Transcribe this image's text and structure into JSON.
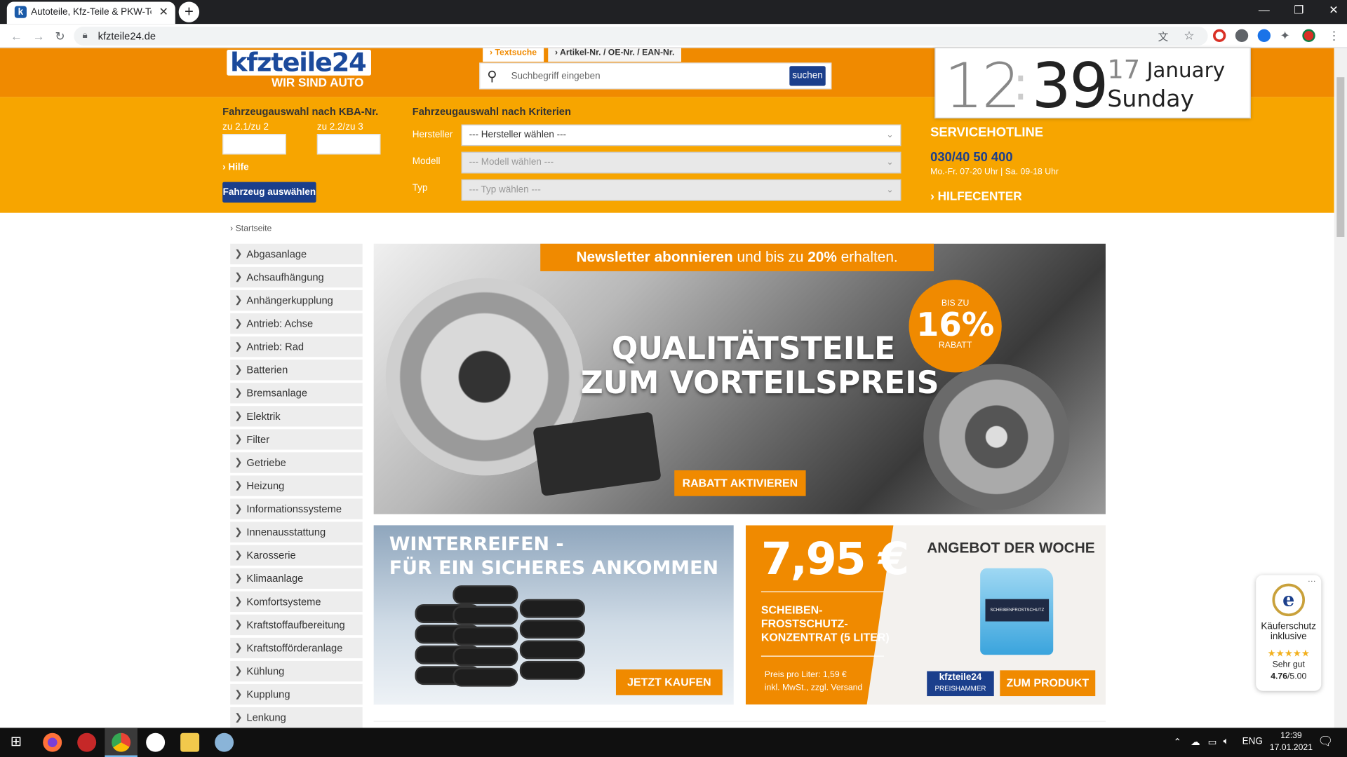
{
  "browser": {
    "tab_title": "Autoteile, Kfz-Teile & PKW-Teile",
    "tab_favicon": "k",
    "url": "kfzteile24.de"
  },
  "header": {
    "logo_text": "kfzteile24",
    "logo_tagline": "WIR SIND AUTO",
    "search_tab_text": "Textsuche",
    "search_tab_article": "Artikel-Nr. / OE-Nr. / EAN-Nr.",
    "search_placeholder": "Suchbegriff eingeben",
    "search_button": "suchen"
  },
  "vehicle": {
    "kba_title": "Fahrzeugauswahl nach KBA-Nr.",
    "kba_label1": "zu 2.1/zu 2",
    "kba_label2": "zu 2.2/zu 3",
    "kba_help": "Hilfe",
    "select_button": "Fahrzeug auswählen",
    "criteria_title": "Fahrzeugauswahl nach Kriterien",
    "criteria": [
      {
        "label": "Hersteller",
        "value": "--- Hersteller wählen ---"
      },
      {
        "label": "Modell",
        "value": "--- Modell wählen ---"
      },
      {
        "label": "Typ",
        "value": "--- Typ wählen ---"
      }
    ]
  },
  "hotline": {
    "title": "SERVICEHOTLINE",
    "number": "030/40 50 400",
    "hours": "Mo.-Fr. 07-20 Uhr | Sa. 09-18 Uhr",
    "help_center": "HILFECENTER"
  },
  "clock": {
    "hour": "12",
    "minute": "39",
    "day": "17",
    "month": "January",
    "weekday": "Sunday"
  },
  "breadcrumb": "Startseite",
  "categories": [
    "Abgasanlage",
    "Achsaufhängung",
    "Anhängerkupplung",
    "Antrieb: Achse",
    "Antrieb: Rad",
    "Batterien",
    "Bremsanlage",
    "Elektrik",
    "Filter",
    "Getriebe",
    "Heizung",
    "Informationssysteme",
    "Innenausstattung",
    "Karosserie",
    "Klimaanlage",
    "Komfortsysteme",
    "Kraftstoffaufbereitung",
    "Kraftstofförderanlage",
    "Kühlung",
    "Kupplung",
    "Lenkung"
  ],
  "banner_main": {
    "newsletter_pre": "Newsletter abonnieren",
    "newsletter_mid": " und bis zu ",
    "newsletter_pct": "20%",
    "newsletter_post": " erhalten.",
    "disc_top": "BIS ZU",
    "disc_value": "16%",
    "disc_bottom": "RABATT",
    "headline1": "QUALITÄTSTEILE",
    "headline2": "ZUM VORTEILSPREIS",
    "cta": "RABATT AKTIVIEREN"
  },
  "banner_winter": {
    "headline1": "WINTERREIFEN -",
    "headline2": "FÜR EIN SICHERES ANKOMMEN",
    "cta": "JETZT KAUFEN"
  },
  "banner_offer": {
    "price": "7,95 €",
    "product1": "SCHEIBEN-",
    "product2": "FROSTSCHUTZ-",
    "product3": "KONZENTRAT (5 LITER)",
    "unit_price": "Preis pro Liter: 1,59 €",
    "tax_note": "inkl. MwSt., zzgl. Versand",
    "title": "ANGEBOT DER WOCHE",
    "canister_label": "SCHEIBENFROSTSCHUTZ",
    "badge_top": "kfzteile24",
    "badge_bottom": "PREISHAMMER",
    "cta": "ZUM PRODUKT"
  },
  "trust": {
    "line1": "Käuferschutz",
    "line2": "inklusive",
    "stars": "★★★★★",
    "rating_text": "Sehr gut",
    "score": "4.76",
    "max": "/5.00"
  },
  "taskbar": {
    "lang": "ENG",
    "time": "12:39",
    "date": "17.01.2021"
  },
  "colors": {
    "orange_dark": "#f08a00",
    "orange": "#f7a500",
    "navy": "#1b3f8c"
  }
}
